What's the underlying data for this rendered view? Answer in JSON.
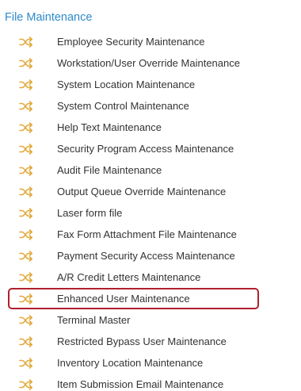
{
  "section": {
    "title": "File Maintenance"
  },
  "colors": {
    "title": "#2e8ac9",
    "icon": "#e2a93a",
    "text": "#333333",
    "highlight_border": "#b0202d"
  },
  "icon_name": "shuffle-icon",
  "highlighted_item": "Enhanced User Maintenance",
  "items": [
    {
      "label": "Employee Security Maintenance"
    },
    {
      "label": "Workstation/User Override Maintenance"
    },
    {
      "label": "System Location Maintenance"
    },
    {
      "label": "System Control Maintenance"
    },
    {
      "label": "Help Text Maintenance"
    },
    {
      "label": "Security Program Access Maintenance"
    },
    {
      "label": "Audit File Maintenance"
    },
    {
      "label": "Output Queue Override Maintenance"
    },
    {
      "label": "Laser form file"
    },
    {
      "label": "Fax Form Attachment File Maintenance"
    },
    {
      "label": "Payment Security Access Maintenance"
    },
    {
      "label": "A/R Credit Letters Maintenance"
    },
    {
      "label": "Enhanced User Maintenance"
    },
    {
      "label": "Terminal Master"
    },
    {
      "label": "Restricted Bypass User Maintenance"
    },
    {
      "label": "Inventory Location Maintenance"
    },
    {
      "label": "Item Submission Email Maintenance"
    }
  ]
}
